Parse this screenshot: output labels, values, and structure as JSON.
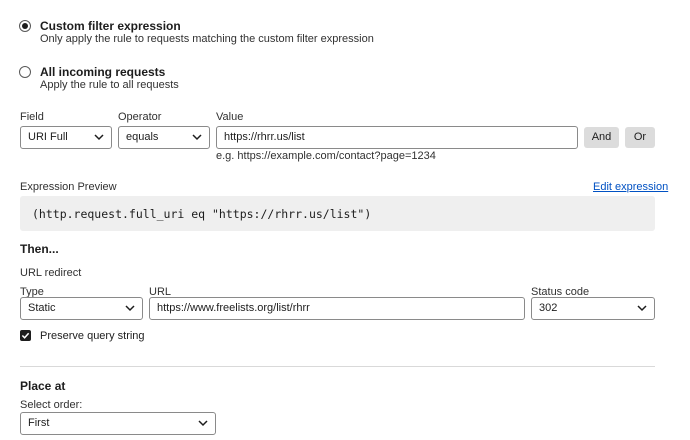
{
  "filter_options": [
    {
      "title": "Custom filter expression",
      "description": "Only apply the rule to requests matching the custom filter expression",
      "selected": true
    },
    {
      "title": "All incoming requests",
      "description": "Apply the rule to all requests",
      "selected": false
    }
  ],
  "field": {
    "label": "Field",
    "value": "URI Full"
  },
  "operator": {
    "label": "Operator",
    "value": "equals"
  },
  "value": {
    "label": "Value",
    "value": "https://rhrr.us/list",
    "hint": "e.g. https://example.com/contact?page=1234"
  },
  "buttons": {
    "and": "And",
    "or": "Or"
  },
  "expression": {
    "label": "Expression Preview",
    "edit_link": "Edit expression",
    "code": "(http.request.full_uri eq \"https://rhrr.us/list\")"
  },
  "then": {
    "heading": "Then...",
    "action_label": "URL redirect",
    "type": {
      "label": "Type",
      "value": "Static"
    },
    "url": {
      "label": "URL",
      "value": "https://www.freelists.org/list/rhrr"
    },
    "status": {
      "label": "Status code",
      "value": "302"
    },
    "preserve": {
      "label": "Preserve query string",
      "checked": true
    }
  },
  "place_at": {
    "heading": "Place at",
    "order_label": "Select order:",
    "order_value": "First"
  }
}
